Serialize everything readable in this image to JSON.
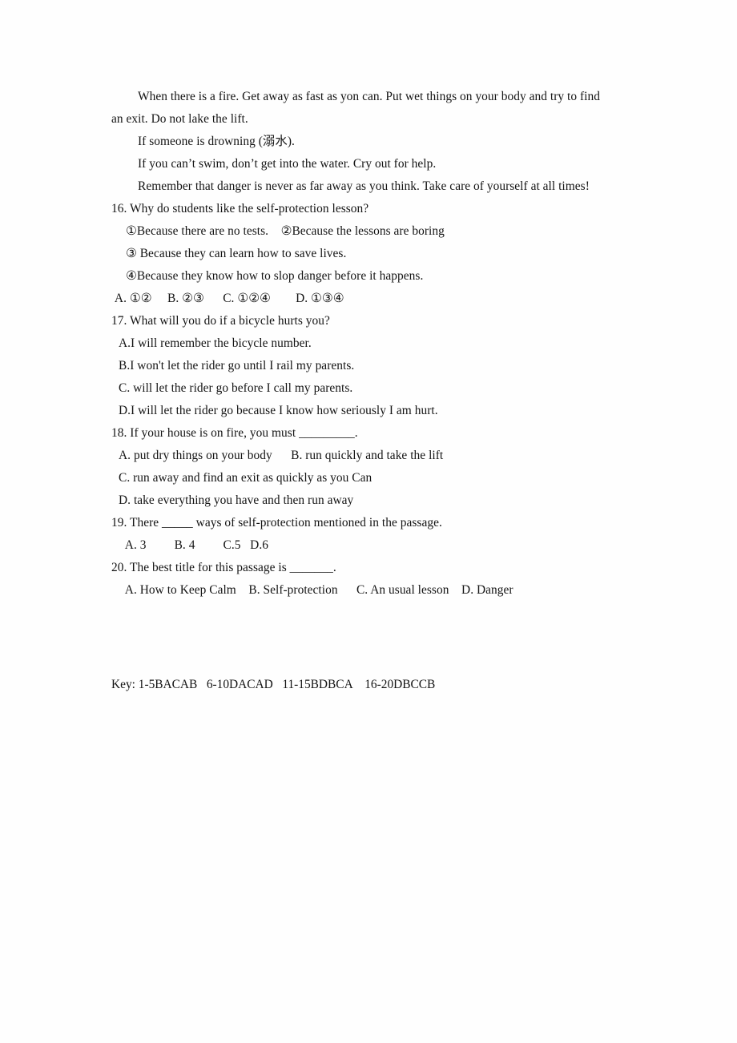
{
  "document": {
    "type": "english-exam-reading-comprehension",
    "passage_lines": [
      "When there is a fire. Get away as fast as yon can. Put wet things on your body and try to find",
      "an exit. Do not lake the lift.",
      "If someone is drowning (溺水).",
      "If you can’t swim, don’t get into the water. Cry out for help.",
      "Remember that danger is never as far away as you think. Take care of yourself at all times!"
    ],
    "questions": [
      {
        "number": "16.",
        "stem": "16. Why do students like the self-protection lesson?",
        "sub_choices": [
          "①Because there are no tests.    ②Because the lessons are boring",
          "③ Because they can learn how to save lives.",
          "④Because they know how to slop danger before it happens."
        ],
        "options_line": " A. ①②     B. ②③      C. ①②④        D. ①③④"
      },
      {
        "number": "17.",
        "stem": "17. What will you do if a bicycle hurts you?",
        "options": [
          "A.I will remember the bicycle number.",
          "B.I won't let the rider go until I rail my parents.",
          "C. will let the rider go before I call my parents.",
          "D.I will let the rider go because I know how seriously I am hurt."
        ]
      },
      {
        "number": "18.",
        "stem": "18. If your house is on fire, you must _________.",
        "options": [
          "A. put dry things on your body      B. run quickly and take the lift",
          "C. run away and find an exit as quickly as you Can",
          "D. take everything you have and then run away"
        ]
      },
      {
        "number": "19.",
        "stem": "19. There _____ ways of self-protection mentioned in the passage.",
        "options_line": "  A. 3         B. 4         C.5   D.6"
      },
      {
        "number": "20.",
        "stem": "20. The best title for this passage is _______.",
        "options_line": "  A. How to Keep Calm    B. Self-protection      C. An usual lesson    D. Danger"
      }
    ],
    "answer_key": "Key: 1-5BACAB   6-10DACAD   11-15BDBCA    16-20DBCCB"
  }
}
